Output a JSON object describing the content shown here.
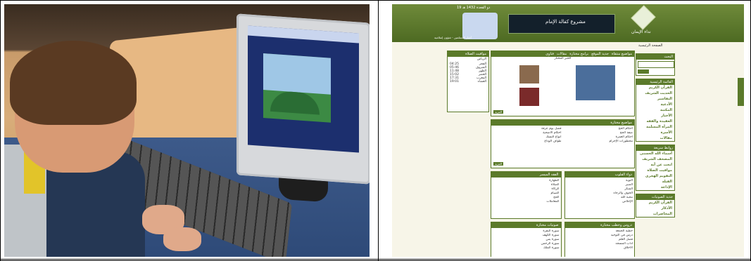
{
  "site": {
    "date": "19 ذو القعدة 1432 هـ",
    "banner": "مشروع كفالة الإمام",
    "logo": "نداء الإيمان",
    "ticker": "أخبار المسلمين - شؤون إسلامية",
    "home": "الصفحة الرئيسية",
    "search_title": "البحث",
    "main_menu_title": "القائمة الرئيسية",
    "main_menu": [
      "القرآن الكريم",
      "الحديث الشريف",
      "التفاسير",
      "الأدعية",
      "المكتبة",
      "الأخبار",
      "العقيدة والفقه",
      "المرأة المسلمة",
      "الأسرة",
      "مقالات"
    ],
    "quick_links_title": "روابط سريعة",
    "quick_links": [
      "أسماء الله الحسنى",
      "المصحف الشريف",
      "ابحث عن آية",
      "مواقيت الصلاة",
      "التقويم الهجري",
      "القبلة",
      "الإذاعة"
    ],
    "tabs": [
      "مواضيع منتقاة",
      "جديد الموقع",
      "برامج مختارة",
      "مقالات",
      "فتاوى"
    ],
    "news_title": "الخبر المختار",
    "selected_title": "مواضيع مختارة",
    "selected_items": [
      "أحكام الحج",
      "صفة الحج",
      "أحكام العمرة",
      "محظورات الإحرام",
      "فضل يوم عرفة",
      "أحكام الأضحية",
      "أنواع النسك",
      "طواف الوداع"
    ],
    "heart_title": "دواء القلوب",
    "heart_items": [
      "التوبة",
      "الصبر",
      "الشكر",
      "الخوف والرجاء",
      "محبة الله",
      "الإخلاص"
    ],
    "fiqh_title": "الفقه الميسر",
    "fiqh_items": [
      "الطهارة",
      "الصلاة",
      "الزكاة",
      "الصيام",
      "الحج",
      "المعاملات"
    ],
    "lessons_title": "دروس وخطب مختارة",
    "lessons_items": [
      "خطبة الجمعة",
      "درس في التوحيد",
      "فضل العلم",
      "آداب المسجد",
      "الأخلاق"
    ],
    "audio_title": "صوتيات مختارة",
    "audio_items": [
      "سورة البقرة",
      "سورة الكهف",
      "سورة يس",
      "سورة الرحمن",
      "سورة الملك"
    ],
    "prayer_title": "مواقيت الصلاة",
    "prayer_city": "الرياض",
    "prayer_times": [
      {
        "name": "الفجر",
        "time": "04:25"
      },
      {
        "name": "الشروق",
        "time": "05:46"
      },
      {
        "name": "الظهر",
        "time": "11:48"
      },
      {
        "name": "العصر",
        "time": "15:02"
      },
      {
        "name": "المغرب",
        "time": "17:31"
      },
      {
        "name": "العشاء",
        "time": "19:01"
      }
    ],
    "more_label": "المزيد",
    "latest_title": "جديد الصوتيات",
    "latest_items": [
      "القرآن الكريم",
      "الأذكار",
      "المحاضرات"
    ]
  }
}
